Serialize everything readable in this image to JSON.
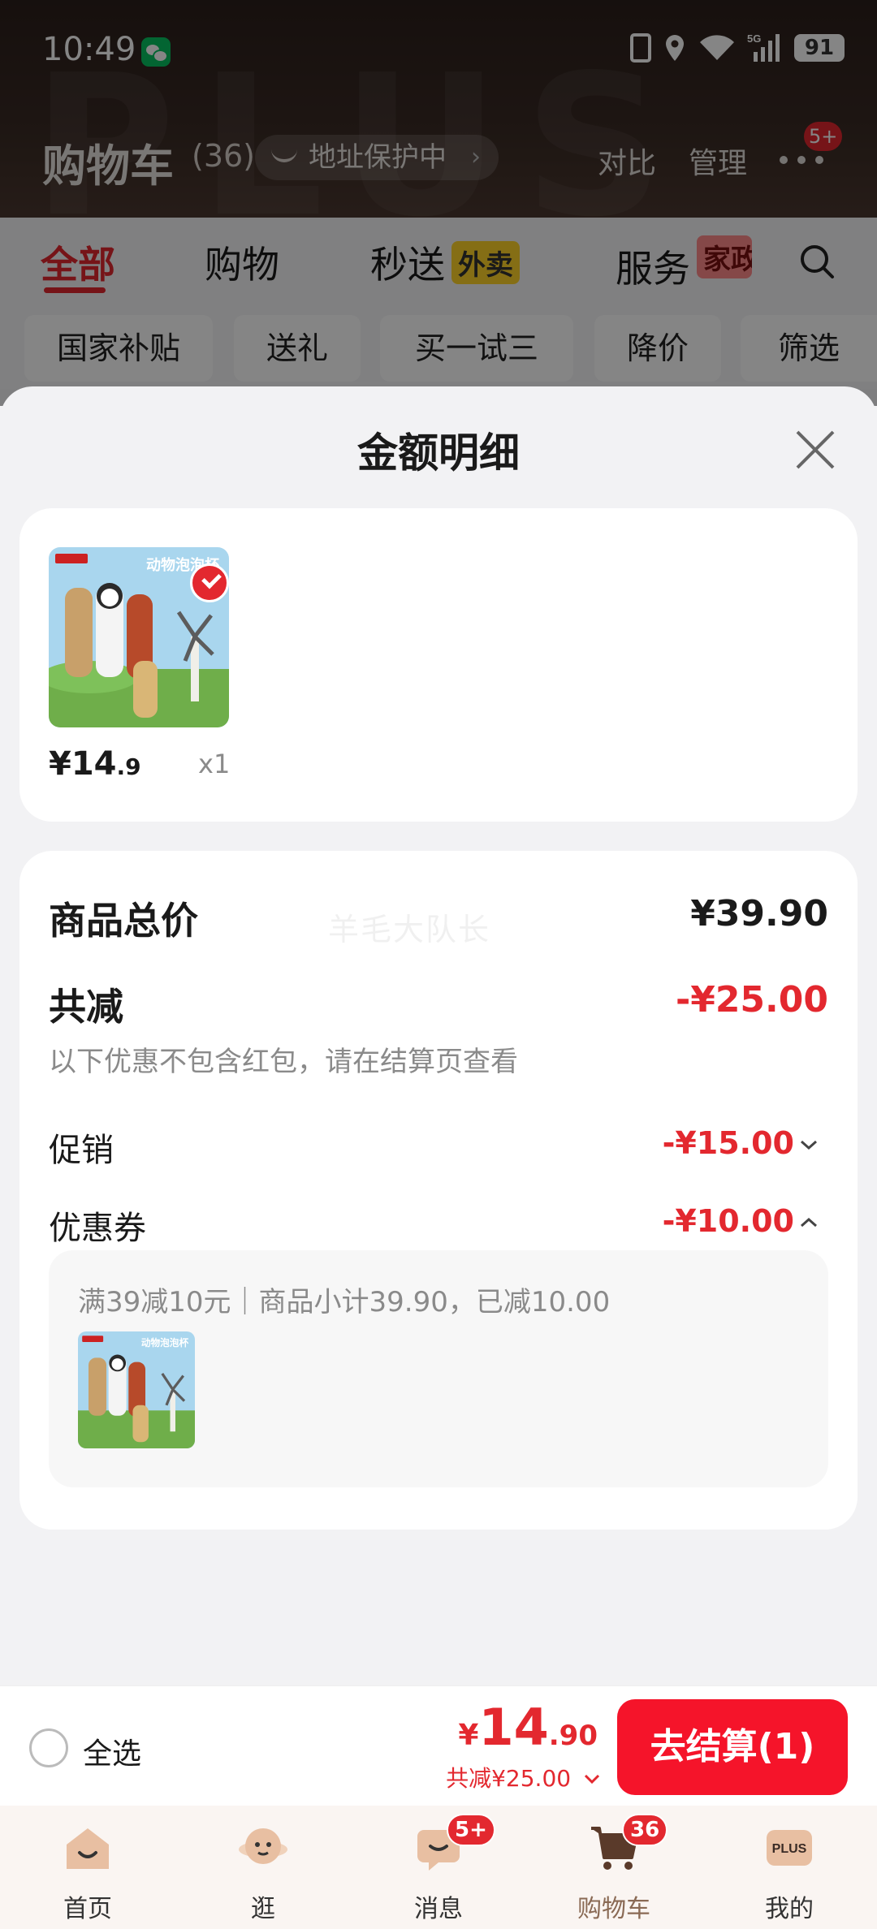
{
  "status_bar": {
    "time": "10:49",
    "battery": "91",
    "network": "5G"
  },
  "header": {
    "title": "购物车",
    "count": "(36)",
    "address_protect": "地址保护中",
    "compare": "对比",
    "manage": "管理",
    "more_badge": "5+"
  },
  "tabs": [
    {
      "label": "全部"
    },
    {
      "label": "购物"
    },
    {
      "label": "秒送",
      "tag": "外卖"
    },
    {
      "label": "服务",
      "tag": "家政"
    }
  ],
  "chips": [
    "国家补贴",
    "送礼",
    "买一试三",
    "降价",
    "筛选"
  ],
  "sheet": {
    "title": "金额明细",
    "item": {
      "price_int": "¥14",
      "price_dec": ".9",
      "qty": "x1"
    },
    "watermark": "羊毛大队长",
    "total_label": "商品总价",
    "total_value": "¥39.90",
    "discount_label": "共减",
    "discount_value": "-¥25.00",
    "note": "以下优惠不包含红包，请在结算页查看",
    "promo_label": "促销",
    "promo_value": "-¥15.00",
    "coupon_label": "优惠券",
    "coupon_value": "-¥10.00",
    "coupon_detail": "满39减10元｜商品小计39.90，已减10.00"
  },
  "checkout": {
    "select_all": "全选",
    "currency": "¥",
    "total_int": "14",
    "total_dec": ".90",
    "total_discount": "共减¥25.00",
    "button": "去结算(1)"
  },
  "tabbar": [
    {
      "label": "首页",
      "icon": "home-icon"
    },
    {
      "label": "逛",
      "icon": "explore-icon"
    },
    {
      "label": "消息",
      "icon": "message-icon",
      "badge": "5+"
    },
    {
      "label": "购物车",
      "icon": "cart-icon",
      "badge": "36"
    },
    {
      "label": "我的",
      "icon": "plus-icon",
      "icon_text": "PLUS"
    }
  ],
  "colors": {
    "accent": "#e3282f",
    "button": "#f5142a",
    "header_bg": "#3a2b25",
    "tag_yellow": "#ffd42a"
  }
}
